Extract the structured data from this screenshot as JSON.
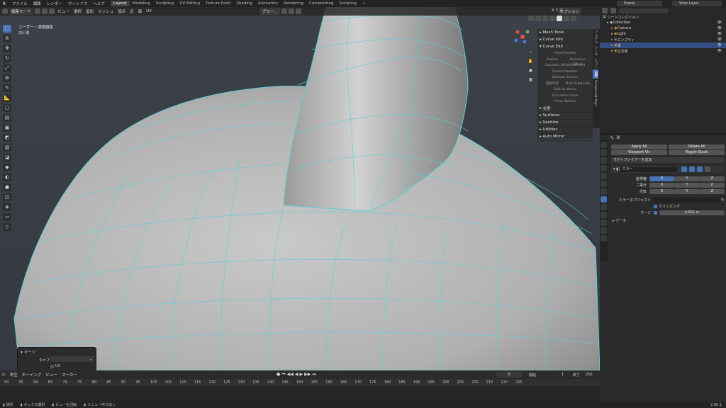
{
  "topbar": {
    "menus": [
      "ファイル",
      "編集",
      "レンダー",
      "ウィンドウ",
      "ヘルプ"
    ],
    "workspaces": [
      "Layout",
      "Modeling",
      "Sculpting",
      "UV Editing",
      "Texture Paint",
      "Shading",
      "Animation",
      "Rendering",
      "Compositing",
      "Scripting"
    ],
    "active_workspace": "Layout",
    "add_tab": "+",
    "scene": "Scene",
    "view_layer": "View Layer"
  },
  "viewport": {
    "mode": "編集モード",
    "menus": [
      "ビュー",
      "選択",
      "追加",
      "メッシュ",
      "頂点",
      "辺",
      "面",
      "UV"
    ],
    "view_name": "ユーザー・透視投影",
    "object_name": "(0) 球",
    "orientation": "グロー...",
    "options": "オプション",
    "xyz": [
      "X",
      "Y",
      "Z"
    ]
  },
  "npanel": {
    "sections_top": [
      "Mesh Tools",
      "Curve Info",
      "Curve Edit"
    ],
    "curve_edit_buttons": [
      "Fillet/Chamfer"
    ],
    "row1": [
      "Outline",
      "Recursive Offset"
    ],
    "buttons2": [
      "Separate Offset/Selected",
      "Extend Handles",
      "Boolean Splines"
    ],
    "row2": [
      "開始付近",
      "Multi Subdivide"
    ],
    "buttons3": [
      "Split at Vertex",
      "Discretize Curve",
      "Array Splines"
    ],
    "sections_bottom": [
      "交差",
      "Surfaces",
      "Sanitize",
      "Utilities",
      "Auto Mirror"
    ],
    "vtabs": [
      "アイテム",
      "ツール",
      "ビュー",
      "編集",
      "Screencast Keys"
    ]
  },
  "merge_panel": {
    "title": "マージ",
    "type_label": "タイプ",
    "type_value": "",
    "uv_label": "UV"
  },
  "timeline": {
    "menus": [
      "再生",
      "キーイング",
      "ビュー",
      "マーカー"
    ],
    "current_frame": "0",
    "start_label": "開始",
    "start_value": "1",
    "end_label": "終了",
    "end_value": "250",
    "ticks": [
      "50",
      "55",
      "60",
      "65",
      "70",
      "75",
      "80",
      "85",
      "90",
      "95",
      "100",
      "105",
      "110",
      "115",
      "120",
      "125",
      "130",
      "135",
      "140",
      "145",
      "150",
      "155",
      "160",
      "165",
      "170",
      "175",
      "180",
      "185",
      "190",
      "195",
      "200",
      "205",
      "210",
      "215",
      "220",
      "225"
    ]
  },
  "statusbar": {
    "items": [
      "選択",
      "ボックス選択",
      "ビューを回転",
      "メニュー呼び出し"
    ],
    "version": "2.90.1"
  },
  "outliner": {
    "header": "シーンコレクション",
    "rows": [
      {
        "name": "Collection",
        "indent": 1,
        "selected": false,
        "color": "#cccccc"
      },
      {
        "name": "Camera",
        "indent": 2,
        "selected": false,
        "color": "#e0a050"
      },
      {
        "name": "Light",
        "indent": 2,
        "selected": false,
        "color": "#e0a050"
      },
      {
        "name": "エンプティ",
        "indent": 2,
        "selected": false,
        "color": "#8a8a8a"
      },
      {
        "name": "球",
        "indent": 2,
        "selected": true,
        "color": "#e0a050"
      },
      {
        "name": "立方体",
        "indent": 2,
        "selected": false,
        "color": "#e0a050"
      }
    ]
  },
  "properties": {
    "object_name": "球",
    "apply_all": "Apply All",
    "delete_all": "Delete All",
    "viewport_vis": "Viewport Vis",
    "toggle_stack": "Toggle Stack",
    "add_modifier": "モディファイアーを追加",
    "modifier_name": "ミラー",
    "axis_label": "座標軸",
    "bisect_label": "二等分",
    "flip_label": "反転",
    "axes": [
      "X",
      "Y",
      "Z"
    ],
    "mirror_object_label": "ミラーオブジェクト",
    "clipping_label": "クリッピング",
    "merge_label": "マージ",
    "merge_value": "0.001 m",
    "data_label": "データ"
  },
  "colors": {
    "accent": "#4772b3",
    "wire": "#5ad0d6",
    "mesh": "#b9b9b9"
  }
}
